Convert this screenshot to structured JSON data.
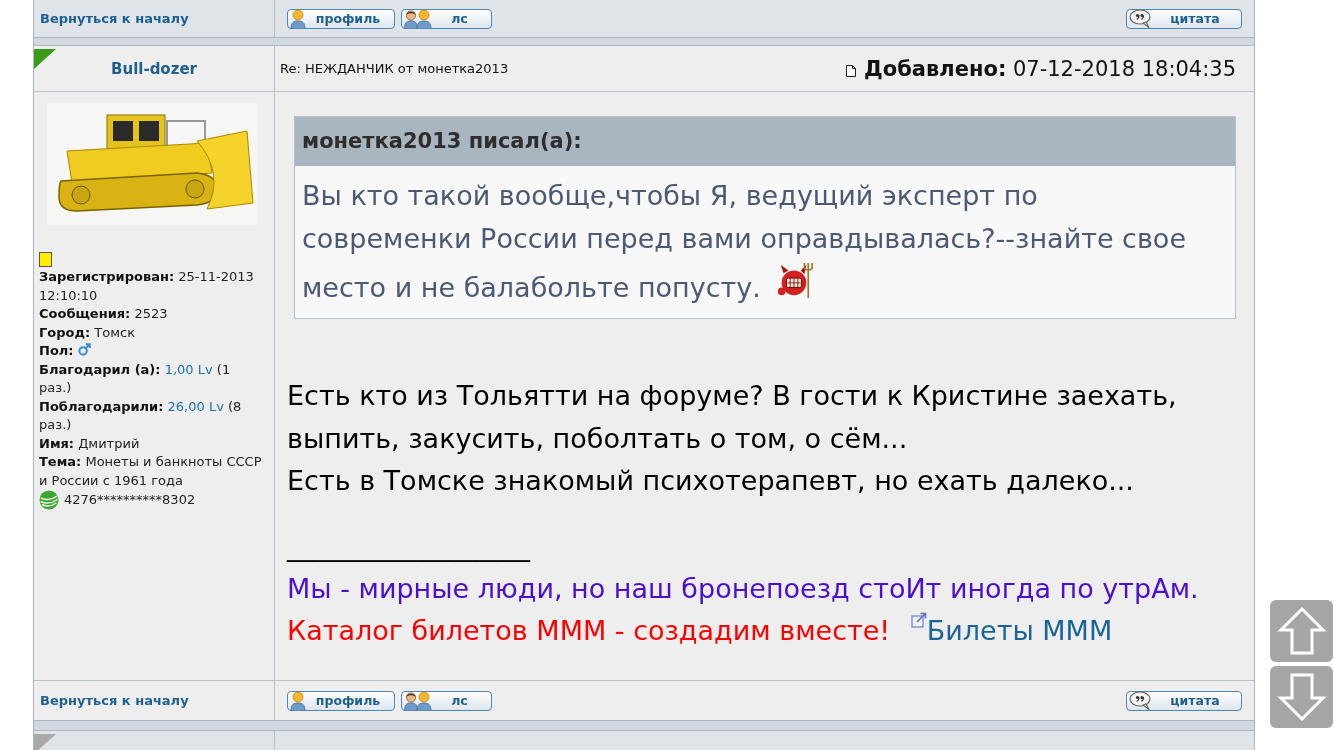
{
  "top_footer": {
    "back_link": "Вернуться к началу",
    "profile_button": "профиль",
    "pm_button": "лс",
    "quote_button": "цитата"
  },
  "post": {
    "author": "Bull-dozer",
    "online": true,
    "subject": "Re: НЕЖДАНЧИК от монетка2013",
    "posted_label": "Добавлено:",
    "posted_at": "07-12-2018 18:04:35",
    "profile_fields": [
      {
        "kind": "text",
        "text": "**Зарегистрирован:** 25-11-2013 12:10:10"
      },
      {
        "kind": "text",
        "text": "**Сообщения:** 2523"
      },
      {
        "kind": "text",
        "text": "**Город:** Томск"
      },
      {
        "kind": "icon",
        "label": "Пол:"
      },
      {
        "kind": "link",
        "label": "Благодарил (а):",
        "link": "1,00 Lv",
        "value": "(1 раз.)"
      },
      {
        "kind": "link",
        "label": "Поблагодарили:",
        "link": "26,00 Lv",
        "value": "(8 раз.)"
      },
      {
        "kind": "text",
        "text": "**Имя:** Дмитрий"
      },
      {
        "kind": "text",
        "text": "**Тема:** Монеты и банкноты СССР и России с 1961 года"
      }
    ],
    "card_number": "4276**********8302",
    "quote": {
      "header": "монетка2013 писал(а):",
      "text": "Вы кто такой вообще,чтобы Я, ведущий эксперт по современки России перед вами оправдывалась?--знайте свое место и не балабольте попусту."
    },
    "paragraphs": [
      "Есть кто из Тольятти на форуме? В гости к Кристине заехать, выпить, закусить, поболтать о том, о сём...",
      "Есть в Томске знакомый психотерапевт, но ехать далеко..."
    ],
    "signature": {
      "rule": "__________________",
      "lines": [
        {
          "text": "Мы - мирные люди, но наш бронепоезд стоИт иногда по утрАм.",
          "color": "#4b0fd0"
        },
        {
          "text": "Каталог билетов МММ - создадим вместе!",
          "color": "#ff0000",
          "link": "Билеты МММ"
        }
      ]
    },
    "footer": {
      "back_link": "Вернуться к началу",
      "profile_button": "профиль",
      "pm_button": "лс",
      "quote_button": "цитата"
    }
  },
  "next_post": {
    "online": false
  }
}
